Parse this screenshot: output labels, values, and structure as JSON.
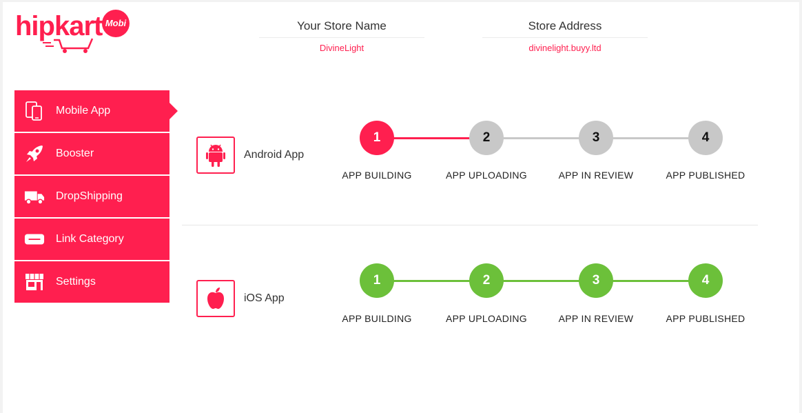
{
  "logo": {
    "text": "hipkart",
    "badge": "Mobi"
  },
  "store": {
    "name_label": "Your Store Name",
    "name_value": "DivineLight",
    "address_label": "Store Address",
    "address_value": "divinelight.buyy.ltd"
  },
  "sidebar": {
    "items": [
      {
        "label": "Mobile App",
        "icon": "mobile-devices-icon",
        "active": true
      },
      {
        "label": "Booster",
        "icon": "rocket-icon",
        "active": false
      },
      {
        "label": "DropShipping",
        "icon": "truck-icon",
        "active": false
      },
      {
        "label": "Link Category",
        "icon": "link-bar-icon",
        "active": false
      },
      {
        "label": "Settings",
        "icon": "store-front-icon",
        "active": false
      }
    ]
  },
  "colors": {
    "brand": "#ff1f4f",
    "active_step": "#ff1f4f",
    "pending_step": "#c8c8c8",
    "done_step": "#6cc03a"
  },
  "android": {
    "name": "Android App",
    "icon": "android-icon",
    "current_step": 1,
    "steps": [
      {
        "num": "1",
        "label": "APP BUILDING",
        "state": "active"
      },
      {
        "num": "2",
        "label": "APP UPLOADING",
        "state": "pending"
      },
      {
        "num": "3",
        "label": "APP IN REVIEW",
        "state": "pending"
      },
      {
        "num": "4",
        "label": "APP PUBLISHED",
        "state": "pending"
      }
    ]
  },
  "ios": {
    "name": "iOS App",
    "icon": "apple-icon",
    "current_step": 4,
    "steps": [
      {
        "num": "1",
        "label": "APP BUILDING",
        "state": "done"
      },
      {
        "num": "2",
        "label": "APP UPLOADING",
        "state": "done"
      },
      {
        "num": "3",
        "label": "APP IN REVIEW",
        "state": "done"
      },
      {
        "num": "4",
        "label": "APP PUBLISHED",
        "state": "done"
      }
    ]
  }
}
